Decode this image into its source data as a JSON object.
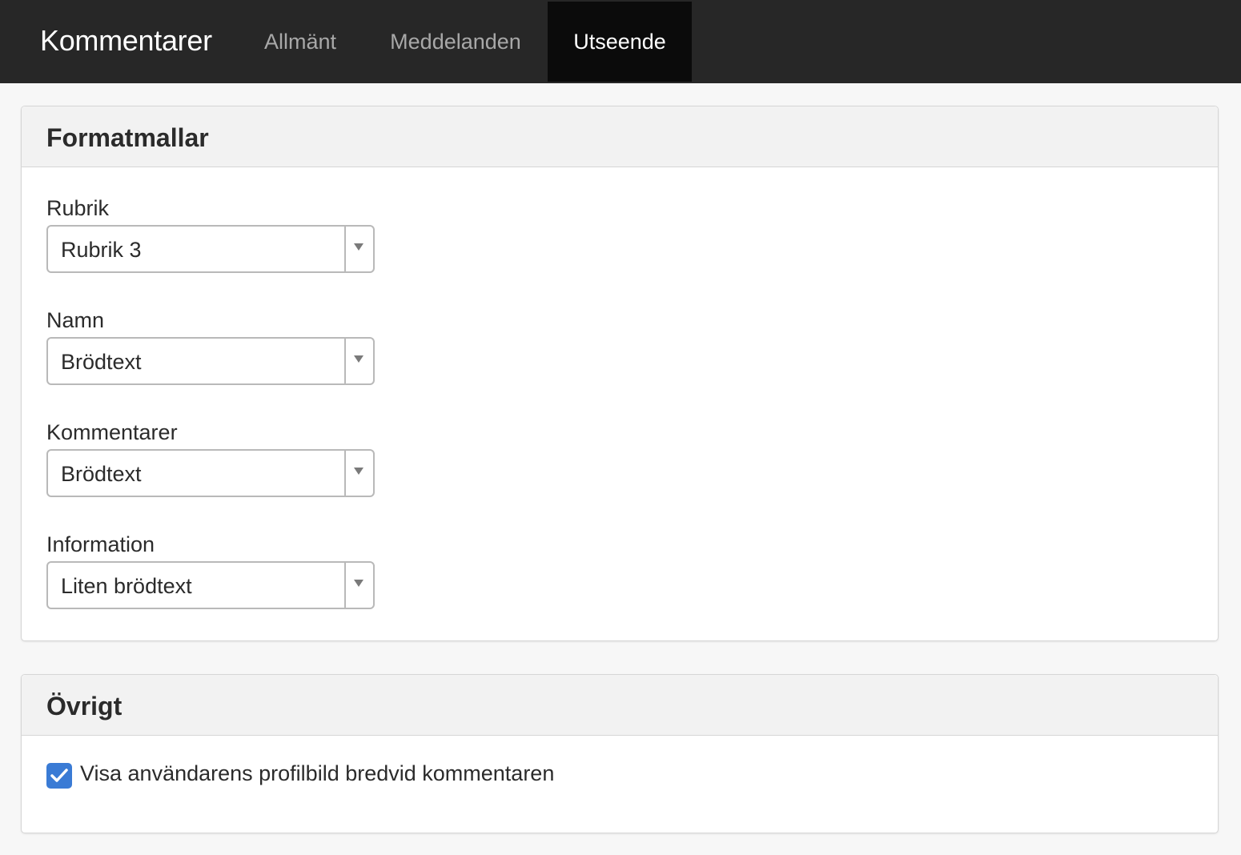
{
  "header": {
    "app_title": "Kommentarer",
    "tabs": [
      {
        "label": "Allmänt",
        "active": false
      },
      {
        "label": "Meddelanden",
        "active": false
      },
      {
        "label": "Utseende",
        "active": true
      }
    ]
  },
  "styles_panel": {
    "title": "Formatmallar",
    "fields": [
      {
        "label": "Rubrik",
        "value": "Rubrik 3"
      },
      {
        "label": "Namn",
        "value": "Brödtext"
      },
      {
        "label": "Kommentarer",
        "value": "Brödtext"
      },
      {
        "label": "Information",
        "value": "Liten brödtext"
      }
    ]
  },
  "other_panel": {
    "title": "Övrigt",
    "checkbox": {
      "label": "Visa användarens profilbild bredvid kommentaren",
      "checked": true
    }
  },
  "colors": {
    "topbar": "#272727",
    "active_tab": "#0b0b0b",
    "checkbox_accent": "#3a7bd5"
  }
}
